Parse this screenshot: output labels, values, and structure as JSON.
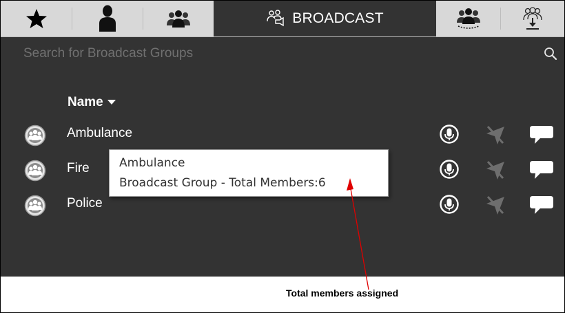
{
  "tabs": [
    {
      "name": "favorites",
      "icon": "star-icon"
    },
    {
      "name": "contacts",
      "icon": "person-icon"
    },
    {
      "name": "groups",
      "icon": "group-icon"
    },
    {
      "name": "broadcast",
      "icon": "broadcast-group-icon",
      "label": "BROADCAST",
      "active": true
    },
    {
      "name": "dynamic-groups",
      "icon": "dynamic-group-icon"
    },
    {
      "name": "download-groups",
      "icon": "download-group-icon"
    }
  ],
  "search": {
    "placeholder": "Search for Broadcast Groups",
    "value": ""
  },
  "list": {
    "header": "Name",
    "sort_icon": "caret-down-icon",
    "rows": [
      {
        "name": "Ambulance"
      },
      {
        "name": "Fire"
      },
      {
        "name": "Police"
      }
    ],
    "row_actions": [
      "ptt-icon",
      "location-off-icon",
      "message-icon"
    ]
  },
  "tooltip": {
    "title": "Ambulance",
    "detail": "Broadcast Group - Total Members:6"
  },
  "annotation": {
    "label": "Total members assigned",
    "color": "#e00000"
  },
  "colors": {
    "panel": "#333333",
    "tabbar": "#d8d8d8",
    "active_tab": "#333333"
  }
}
